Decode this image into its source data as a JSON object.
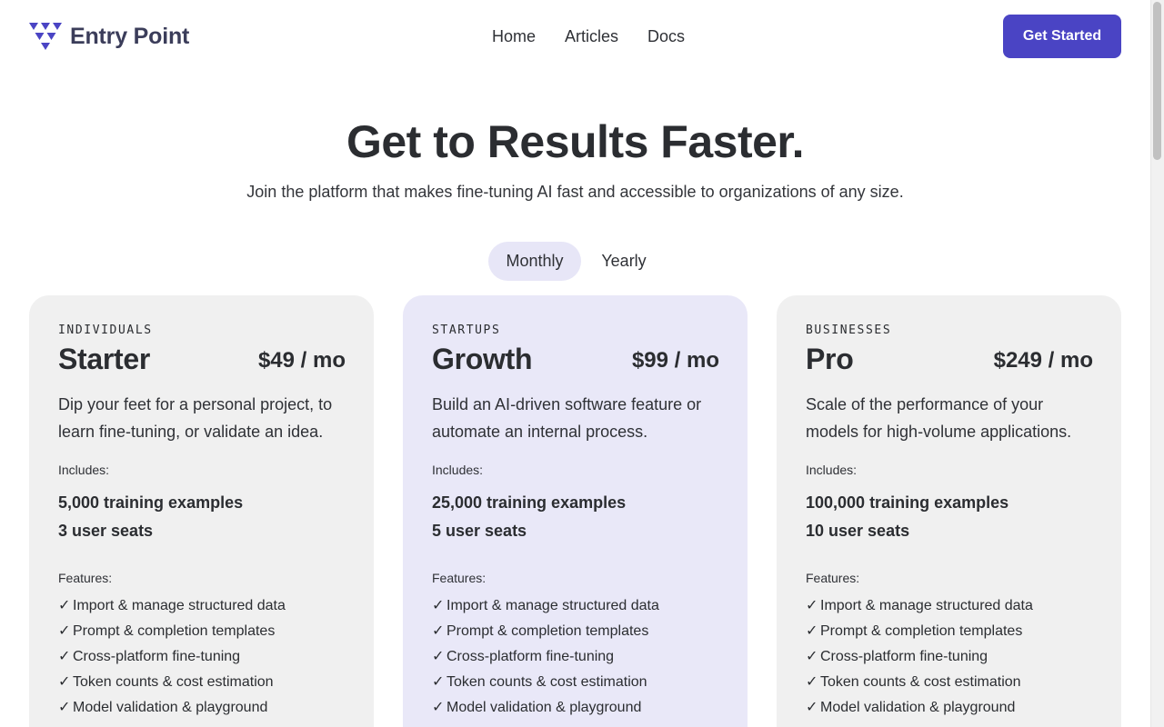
{
  "brand": {
    "name": "Entry Point",
    "accent": "#4a44c4"
  },
  "nav": {
    "home": "Home",
    "articles": "Articles",
    "docs": "Docs"
  },
  "cta": {
    "label": "Get Started"
  },
  "hero": {
    "title": "Get to Results Faster.",
    "subtitle": "Join the platform that makes fine-tuning AI fast and accessible to organizations of any size."
  },
  "billing_toggle": {
    "options": [
      "Monthly",
      "Yearly"
    ],
    "selected": "Monthly"
  },
  "plans": [
    {
      "tier": "INDIVIDUALS",
      "name": "Starter",
      "price": "$49 / mo",
      "description": "Dip your feet for a personal project, to learn fine-tuning, or validate an idea.",
      "includes_label": "Includes:",
      "includes": [
        "5,000 training examples",
        "3 user seats"
      ],
      "features_label": "Features:",
      "features": [
        "Import & manage structured data",
        "Prompt & completion templates",
        "Cross-platform fine-tuning",
        "Token counts & cost estimation",
        "Model validation & playground"
      ]
    },
    {
      "tier": "STARTUPS",
      "name": "Growth",
      "price": "$99 / mo",
      "description": "Build an AI-driven software feature or automate an internal process.",
      "includes_label": "Includes:",
      "includes": [
        "25,000 training examples",
        "5 user seats"
      ],
      "features_label": "Features:",
      "features": [
        "Import & manage structured data",
        "Prompt & completion templates",
        "Cross-platform fine-tuning",
        "Token counts & cost estimation",
        "Model validation & playground"
      ]
    },
    {
      "tier": "BUSINESSES",
      "name": "Pro",
      "price": "$249 / mo",
      "description": "Scale of the performance of your models for high-volume applications.",
      "includes_label": "Includes:",
      "includes": [
        "100,000 training examples",
        "10 user seats"
      ],
      "features_label": "Features:",
      "features": [
        "Import & manage structured data",
        "Prompt & completion templates",
        "Cross-platform fine-tuning",
        "Token counts & cost estimation",
        "Model validation & playground"
      ]
    }
  ],
  "icons": {
    "logo": "triangle-grid-logo-icon",
    "check": "check-icon"
  },
  "check_glyph": "✓"
}
